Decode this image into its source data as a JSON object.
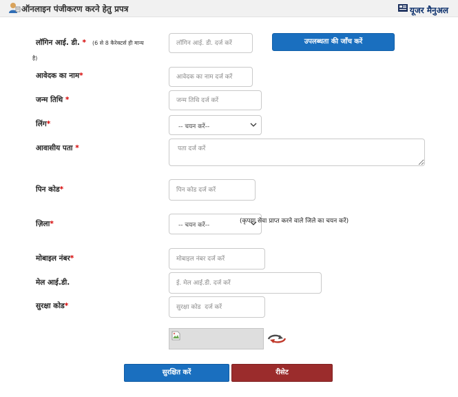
{
  "header": {
    "title": "ऑनलाइन पंजीकरण करने हेतु प्रपत्र",
    "user_manual": "यूजर मैनुअल"
  },
  "form": {
    "login_id": {
      "label": "लॉगिन आई. डी.",
      "required": "*",
      "hint_line1": "(6 से 8 कैरेक्टर्स ही मान्य",
      "hint_line2": "है)",
      "placeholder": "लॉगिन आई. डी. दर्ज करें",
      "check_button": "उपलब्धता की जाँच करें"
    },
    "applicant_name": {
      "label": "आवेदक का नाम",
      "required": "*",
      "placeholder": "आवेदक का नाम दर्ज करें"
    },
    "dob": {
      "label": "जन्म तिथि",
      "required": "*",
      "placeholder": "जन्म तिथि दर्ज करें"
    },
    "gender": {
      "label": "लिंग",
      "required": "*",
      "selected": "-- चयन करें--"
    },
    "address": {
      "label": "आवासीय पता",
      "required": "*",
      "placeholder": "पता दर्ज करें"
    },
    "pincode": {
      "label": "पिन कोड",
      "required": "*",
      "placeholder": "पिन कोड दर्ज करें"
    },
    "district": {
      "label": "ज़िला",
      "required": "*",
      "selected": "-- चयन करें--",
      "note": "(कृपया सेवा प्राप्त करने वाले जिले का चयन करें)"
    },
    "mobile": {
      "label": "मोबाइल नंबर",
      "required": "*",
      "placeholder": "मोबाइल नंबर दर्ज करें"
    },
    "email": {
      "label": "मेल आई.डी.",
      "placeholder": "ई. मेल आई.डी. दर्ज करें"
    },
    "security_code": {
      "label": "सुरक्षा कोड",
      "required": "*",
      "placeholder": "सुरक्षा कोड  दर्ज करें"
    }
  },
  "actions": {
    "save": "सुरक्षित करें",
    "reset": "रीसेट"
  },
  "colors": {
    "primary": "#1a6fbf",
    "danger": "#9b2c2c",
    "required": "#d40000",
    "manual_link": "#0b2f6b"
  },
  "icons": [
    "user-icon",
    "user-manual-icon",
    "chevron-down-icon",
    "broken-image-icon",
    "refresh-icon"
  ]
}
